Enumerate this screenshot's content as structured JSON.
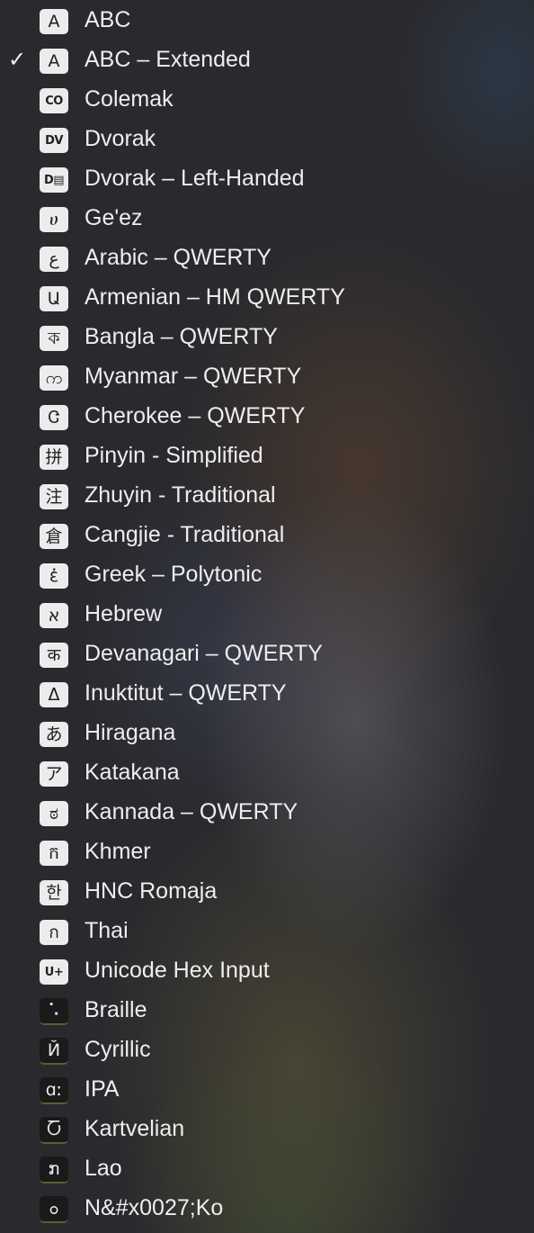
{
  "menu": {
    "items": [
      {
        "label": "ABC",
        "icon": "A",
        "icon_name": "latin-a-icon",
        "checked": false
      },
      {
        "label": "ABC – Extended",
        "icon": "A",
        "icon_name": "latin-a-icon",
        "checked": true
      },
      {
        "label": "Colemak",
        "icon": "CO",
        "icon_name": "colemak-icon",
        "checked": false
      },
      {
        "label": "Dvorak",
        "icon": "DV",
        "icon_name": "dvorak-icon",
        "checked": false
      },
      {
        "label": "Dvorak – Left-Handed",
        "icon": "D▤",
        "icon_name": "dvorak-left-icon",
        "checked": false
      },
      {
        "label": "Ge'ez",
        "icon": "ሀ",
        "icon_name": "geez-icon",
        "checked": false
      },
      {
        "label": "Arabic – QWERTY",
        "icon": "ع",
        "icon_name": "arabic-icon",
        "checked": false
      },
      {
        "label": "Armenian – HM QWERTY",
        "icon": "Ա",
        "icon_name": "armenian-icon",
        "checked": false
      },
      {
        "label": "Bangla – QWERTY",
        "icon": "ক",
        "icon_name": "bangla-icon",
        "checked": false
      },
      {
        "label": "Myanmar – QWERTY",
        "icon": "က",
        "icon_name": "myanmar-icon",
        "checked": false
      },
      {
        "label": "Cherokee – QWERTY",
        "icon": "Ꮳ",
        "icon_name": "cherokee-icon",
        "checked": false
      },
      {
        "label": "Pinyin - Simplified",
        "icon": "拼",
        "icon_name": "pinyin-icon",
        "checked": false
      },
      {
        "label": "Zhuyin - Traditional",
        "icon": "注",
        "icon_name": "zhuyin-icon",
        "checked": false
      },
      {
        "label": "Cangjie - Traditional",
        "icon": "倉",
        "icon_name": "cangjie-icon",
        "checked": false
      },
      {
        "label": "Greek – Polytonic",
        "icon": "ἐ",
        "icon_name": "greek-icon",
        "checked": false
      },
      {
        "label": "Hebrew",
        "icon": "א",
        "icon_name": "hebrew-icon",
        "checked": false
      },
      {
        "label": "Devanagari – QWERTY",
        "icon": "क",
        "icon_name": "devanagari-icon",
        "checked": false
      },
      {
        "label": "Inuktitut – QWERTY",
        "icon": "ᐃ",
        "icon_name": "inuktitut-icon",
        "checked": false
      },
      {
        "label": "Hiragana",
        "icon": "あ",
        "icon_name": "hiragana-icon",
        "checked": false
      },
      {
        "label": "Katakana",
        "icon": "ア",
        "icon_name": "katakana-icon",
        "checked": false
      },
      {
        "label": "Kannada – QWERTY",
        "icon": "ಠ",
        "icon_name": "kannada-icon",
        "checked": false
      },
      {
        "label": "Khmer",
        "icon": "ក",
        "icon_name": "khmer-icon",
        "checked": false
      },
      {
        "label": "HNC Romaja",
        "icon": "한",
        "icon_name": "hangul-icon",
        "checked": false
      },
      {
        "label": "Thai",
        "icon": "ก",
        "icon_name": "thai-icon",
        "checked": false
      },
      {
        "label": "Unicode Hex Input",
        "icon": "U+",
        "icon_name": "unicode-hex-icon",
        "checked": false
      },
      {
        "label": "Braille",
        "icon": "⠡",
        "icon_name": "braille-icon",
        "checked": false
      },
      {
        "label": "Cyrillic",
        "icon": "Й",
        "icon_name": "cyrillic-icon",
        "checked": false
      },
      {
        "label": "IPA",
        "icon": "ɑː",
        "icon_name": "ipa-icon",
        "checked": false
      },
      {
        "label": "Kartvelian",
        "icon": "Ⴀ",
        "icon_name": "kartvelian-icon",
        "checked": false
      },
      {
        "label": "Lao",
        "icon": "ກ",
        "icon_name": "lao-icon",
        "checked": false
      },
      {
        "label": "N&#x0027;Ko",
        "icon": "ߋ",
        "icon_name": "nko-icon",
        "checked": false
      }
    ]
  },
  "checkmark_glyph": "✓"
}
